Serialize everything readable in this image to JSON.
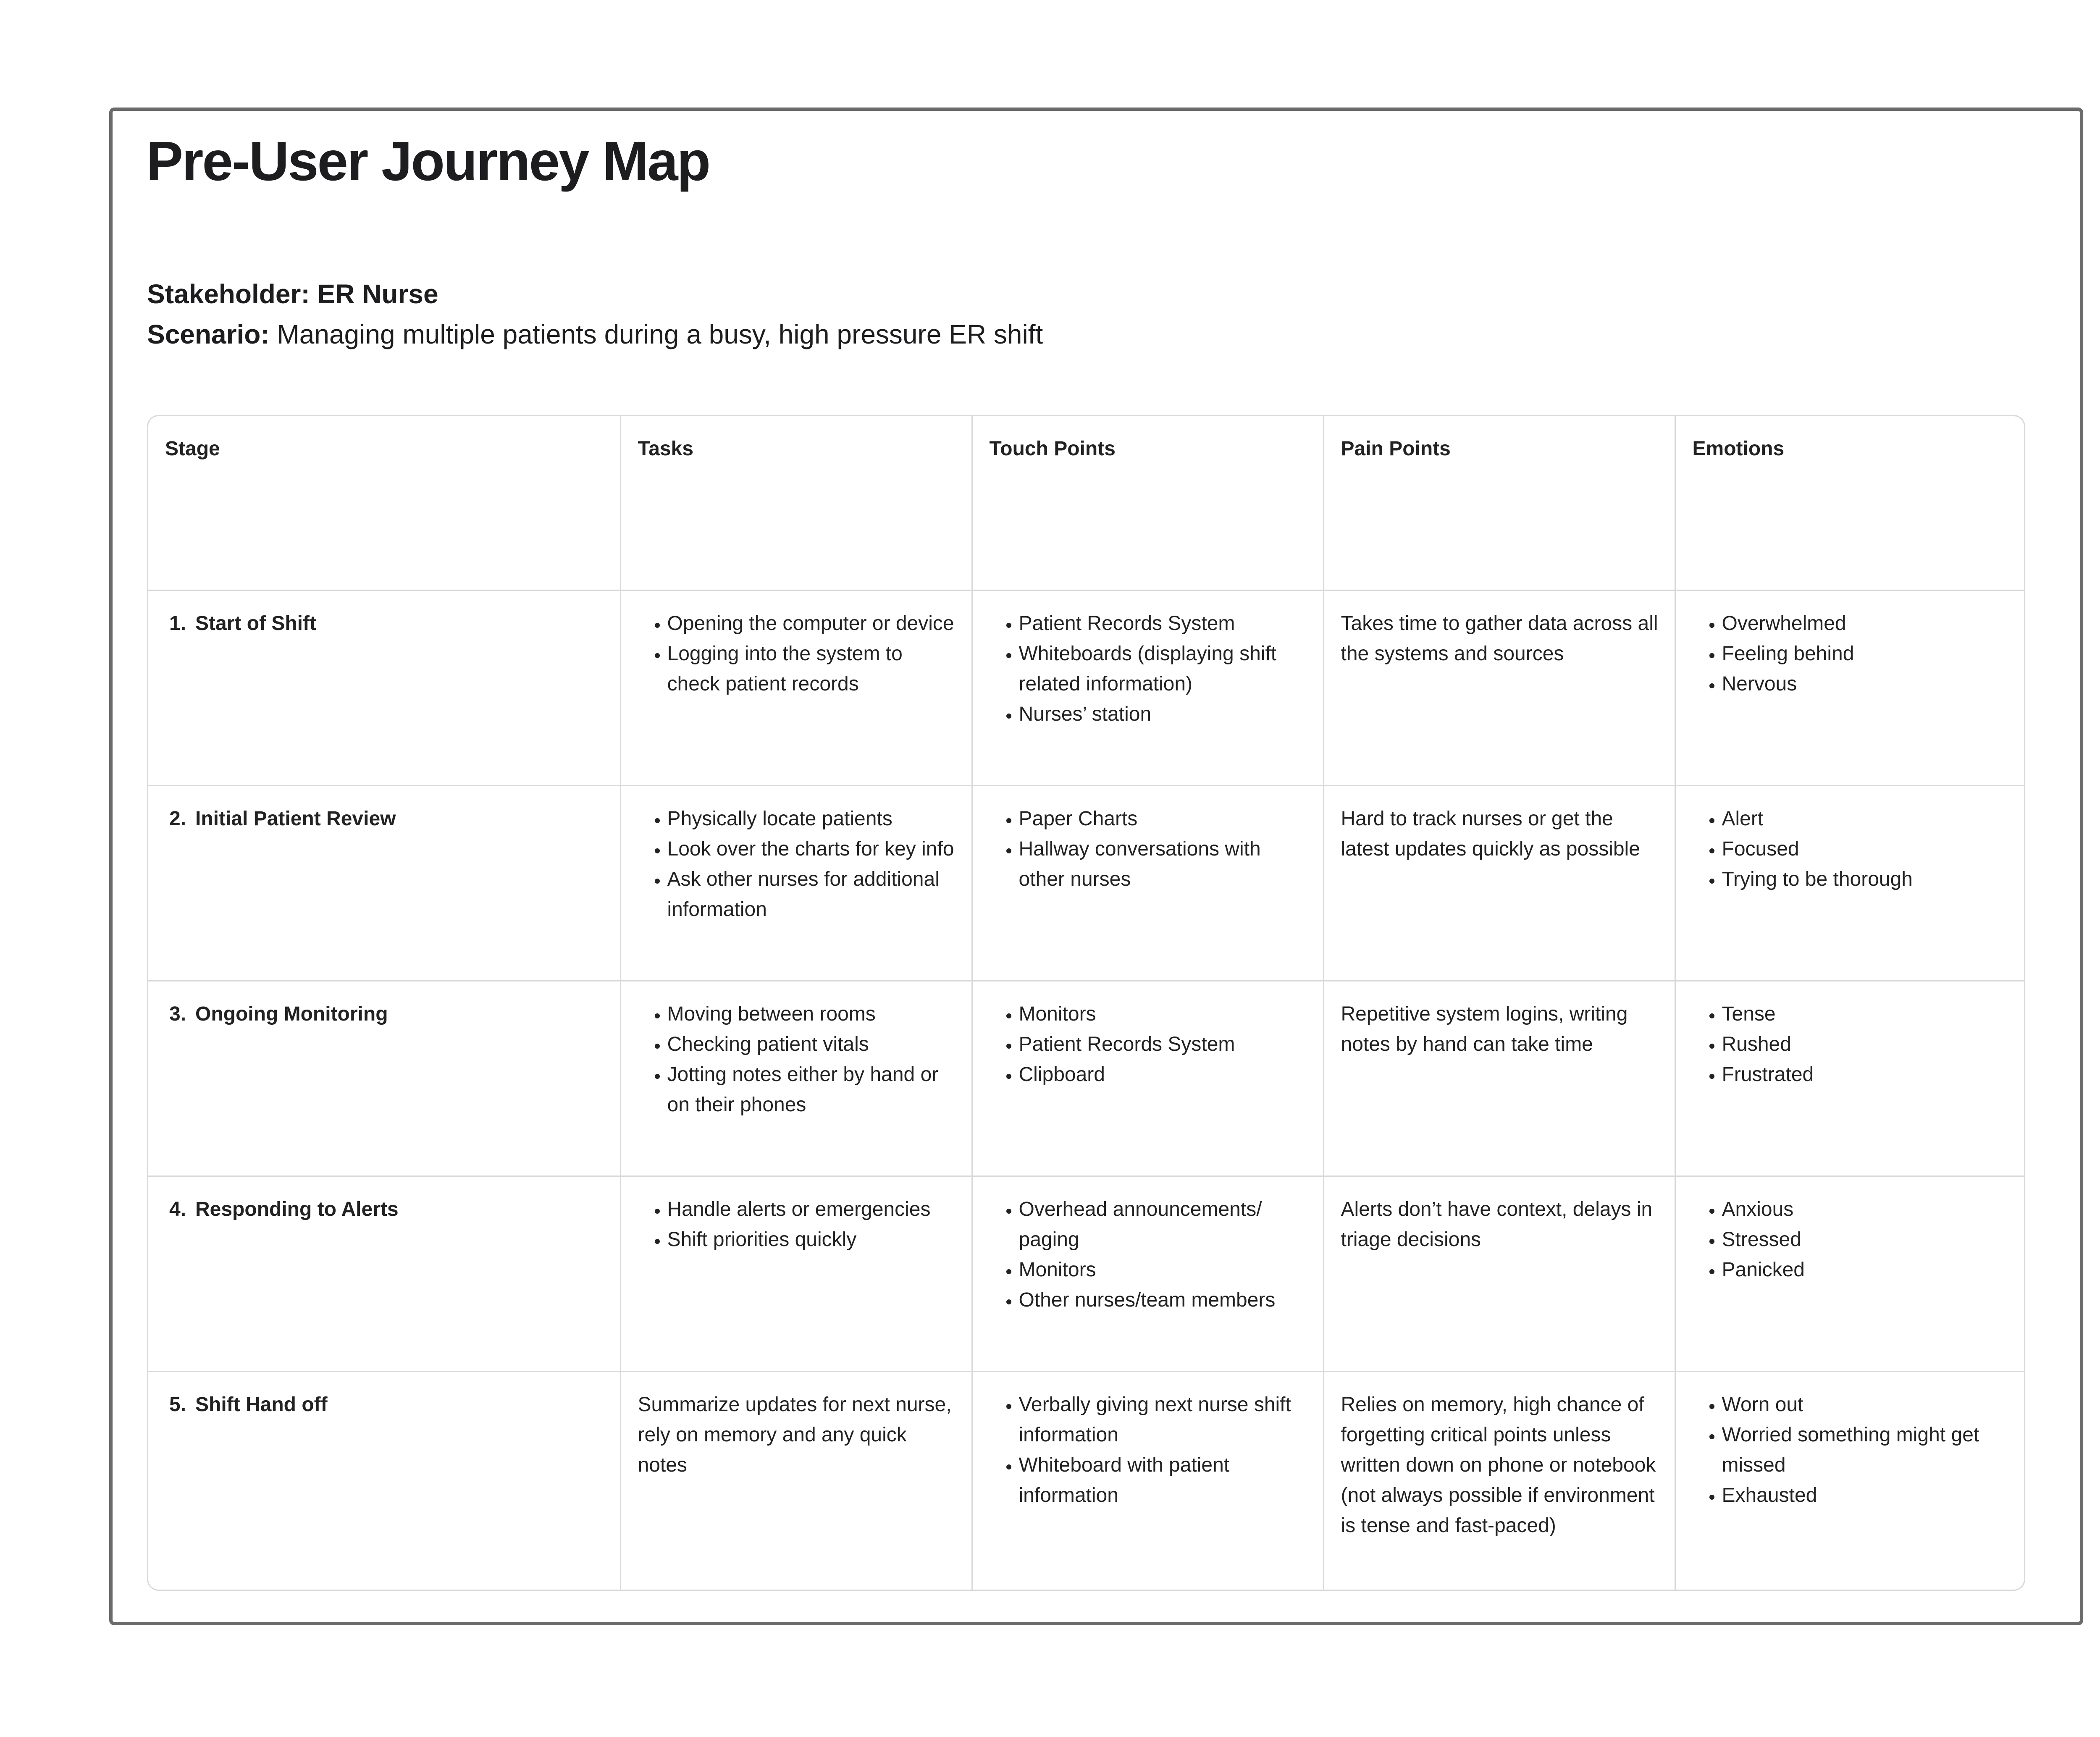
{
  "title": "Pre-User Journey Map",
  "stakeholder": {
    "label": "Stakeholder:",
    "value": "ER Nurse"
  },
  "scenario": {
    "label": "Scenario:",
    "value": "Managing multiple patients during a busy, high pressure ER shift"
  },
  "table": {
    "headers": [
      "Stage",
      "Tasks",
      "Touch Points",
      "Pain Points",
      "Emotions"
    ],
    "rows": [
      {
        "num": "1.",
        "stage": "Start of Shift",
        "tasks": [
          "Opening the computer or device",
          "Logging into the system to check patient records"
        ],
        "touch_points": [
          "Patient Records System",
          "Whiteboards (displaying shift related information)",
          "Nurses’ station"
        ],
        "pain_points": "Takes time to gather data across all the systems and sources",
        "emotions": [
          "Overwhelmed",
          "Feeling behind",
          "Nervous"
        ]
      },
      {
        "num": "2.",
        "stage": "Initial Patient Review",
        "tasks": [
          "Physically locate patients",
          "Look over the charts for key info",
          "Ask other nurses for additional information"
        ],
        "touch_points": [
          "Paper Charts",
          "Hallway conversations with other nurses"
        ],
        "pain_points": "Hard to track nurses or get the latest updates quickly as possible",
        "emotions": [
          "Alert",
          "Focused",
          "Trying to be thorough"
        ]
      },
      {
        "num": "3.",
        "stage": "Ongoing Monitoring",
        "tasks": [
          "Moving between rooms",
          "Checking patient vitals",
          "Jotting notes either by hand or on their phones"
        ],
        "touch_points": [
          "Monitors",
          "Patient Records System",
          "Clipboard"
        ],
        "pain_points": "Repetitive system logins, writing notes by hand can take time",
        "emotions": [
          "Tense",
          "Rushed",
          "Frustrated"
        ]
      },
      {
        "num": "4.",
        "stage": "Responding to Alerts",
        "tasks": [
          "Handle alerts or emergencies",
          "Shift priorities quickly"
        ],
        "touch_points": [
          "Overhead announcements/ paging",
          "Monitors",
          "Other nurses/team members"
        ],
        "pain_points": "Alerts don’t have context, delays in triage decisions",
        "emotions": [
          "Anxious",
          "Stressed",
          "Panicked"
        ]
      },
      {
        "num": "5.",
        "stage": "Shift Hand off",
        "tasks_text": "Summarize updates for next nurse, rely on memory and any quick notes",
        "touch_points": [
          "Verbally giving next nurse shift information",
          "Whiteboard with patient information"
        ],
        "pain_points": "Relies on memory, high chance of forgetting critical points unless written down on phone or notebook (not always possible if environment is tense and fast-paced)",
        "emotions": [
          "Worn out",
          "Worried something might get missed",
          "Exhausted"
        ]
      }
    ]
  }
}
